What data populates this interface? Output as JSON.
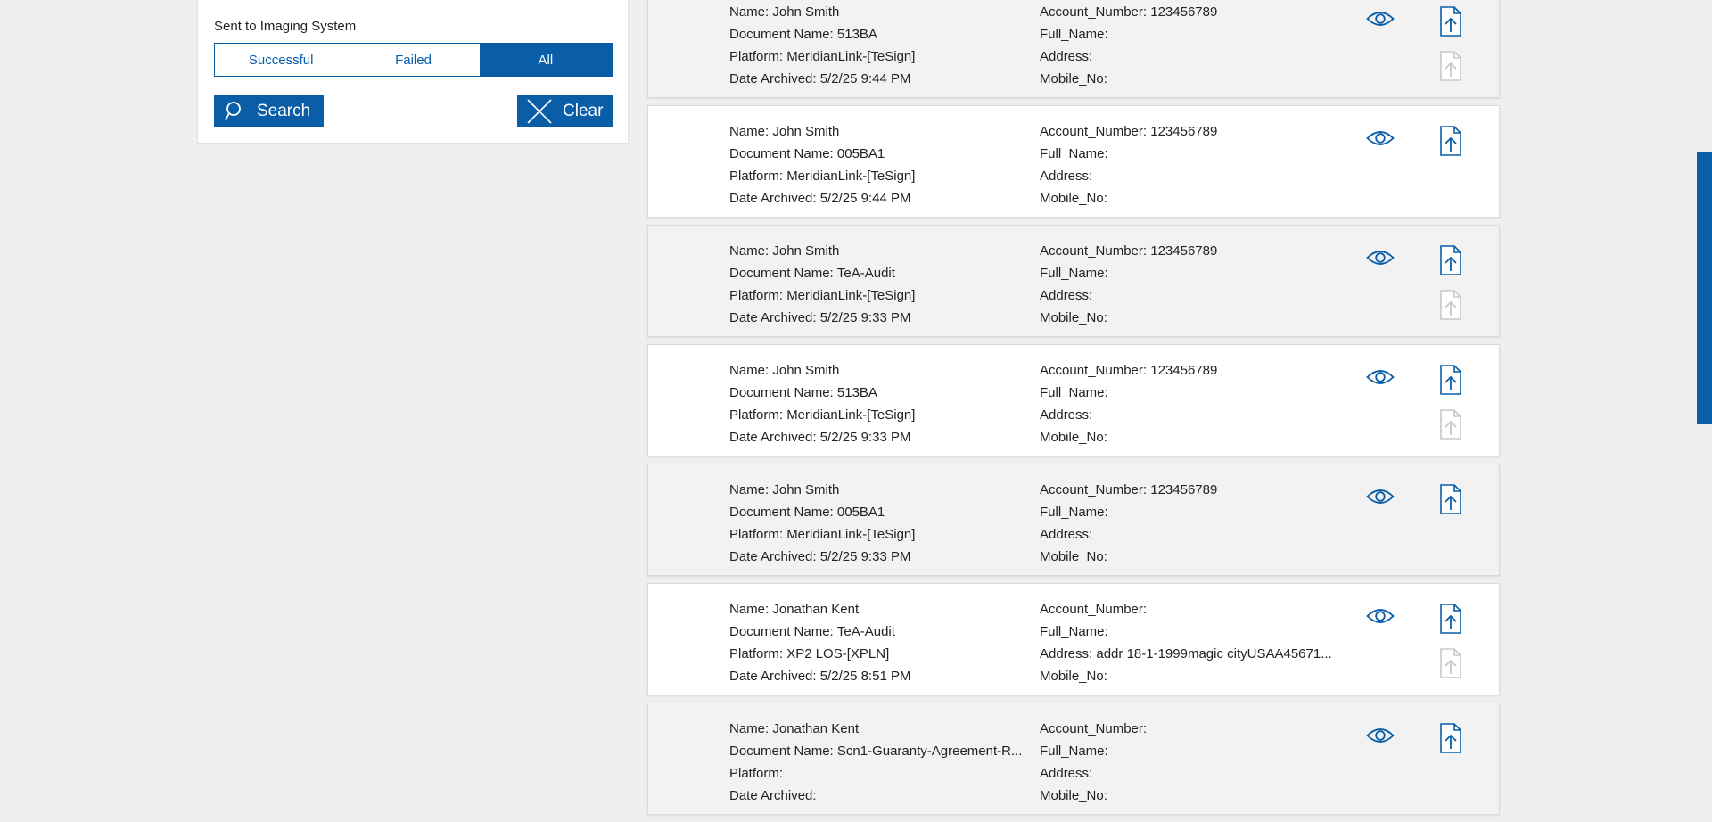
{
  "filter": {
    "label": "Sent to Imaging System",
    "options": [
      "Successful",
      "Failed",
      "All"
    ],
    "selected": "All",
    "search_label": "Search",
    "clear_label": "Clear"
  },
  "labels": {
    "name": "Name: ",
    "document": "Document Name: ",
    "platform": "Platform: ",
    "date": "Date Archived: ",
    "account": "Account_Number: ",
    "full_name": "Full_Name:",
    "address": "Address: ",
    "mobile": "Mobile_No:"
  },
  "records": [
    {
      "name": "John Smith",
      "document": "513BA",
      "platform": "MeridianLink-[TeSign]",
      "date": "5/2/25 9:44 PM",
      "account": "123456789",
      "address": "",
      "second_upload": true
    },
    {
      "name": "John Smith",
      "document": "005BA1",
      "platform": "MeridianLink-[TeSign]",
      "date": "5/2/25 9:44 PM",
      "account": "123456789",
      "address": "",
      "second_upload": false
    },
    {
      "name": "John Smith",
      "document": "TeA-Audit",
      "platform": "MeridianLink-[TeSign]",
      "date": "5/2/25 9:33 PM",
      "account": "123456789",
      "address": "",
      "second_upload": true
    },
    {
      "name": "John Smith",
      "document": "513BA",
      "platform": "MeridianLink-[TeSign]",
      "date": "5/2/25 9:33 PM",
      "account": "123456789",
      "address": "",
      "second_upload": true
    },
    {
      "name": "John Smith",
      "document": "005BA1",
      "platform": "MeridianLink-[TeSign]",
      "date": "5/2/25 9:33 PM",
      "account": "123456789",
      "address": "",
      "second_upload": false
    },
    {
      "name": "Jonathan Kent",
      "document": "TeA-Audit",
      "platform": "XP2 LOS-[XPLN]",
      "date": "5/2/25 8:51 PM",
      "account": "",
      "address": "addr 18-1-1999magic cityUSAA45671...",
      "second_upload": true
    },
    {
      "name": "Jonathan Kent",
      "document": "Scn1-Guaranty-Agreement-R...",
      "platform": "",
      "date": "",
      "account": "",
      "address": "",
      "second_upload": false
    }
  ],
  "colors": {
    "accent": "#0a5ea8",
    "disabled_icon": "#c8c8c8",
    "card_gray": "#f2f2f2",
    "card_white": "#ffffff",
    "page_bg": "#efefef"
  },
  "icons": {
    "view": "eye-icon",
    "upload": "file-upload-icon",
    "search": "search-icon",
    "clear": "close-icon"
  }
}
